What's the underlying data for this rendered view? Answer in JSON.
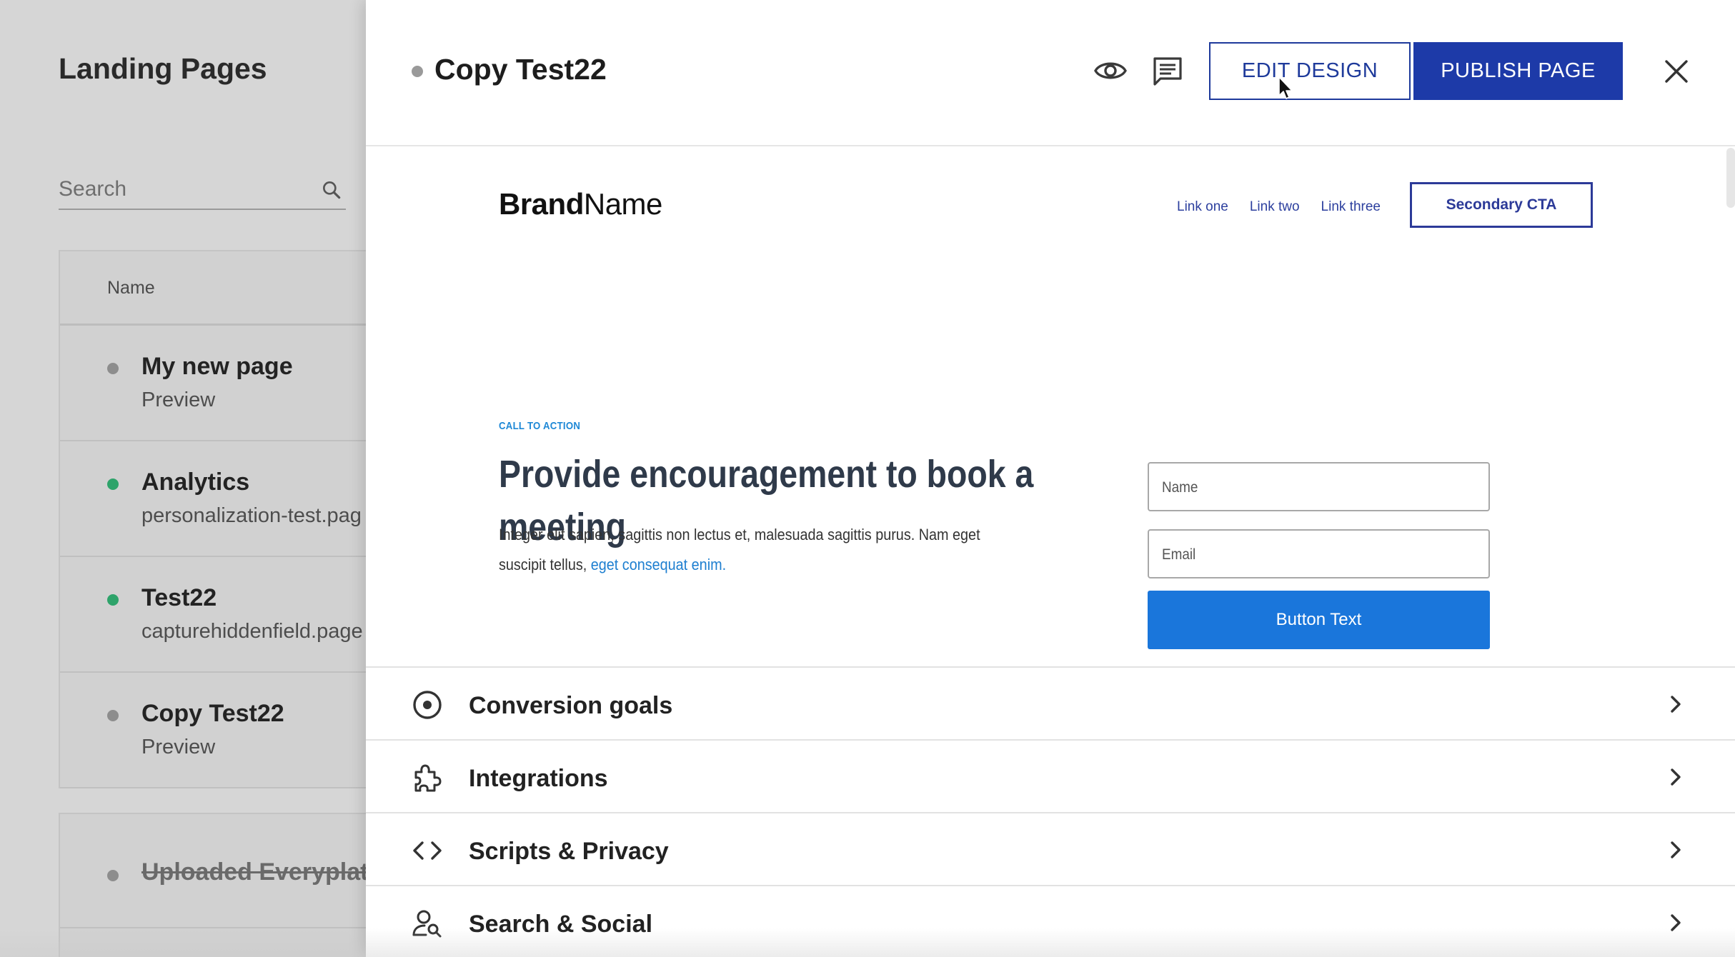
{
  "background": {
    "title": "Landing Pages",
    "search_placeholder": "Search",
    "table_header": "Name",
    "rows": [
      {
        "title": "My new page",
        "subtitle": "Preview",
        "status": "draft"
      },
      {
        "title": "Analytics",
        "subtitle": "personalization-test.pag",
        "status": "published"
      },
      {
        "title": "Test22",
        "subtitle": "capturehiddenfield.page",
        "status": "published"
      },
      {
        "title": "Copy Test22",
        "subtitle": "Preview",
        "status": "draft"
      }
    ],
    "archived_row": {
      "title": "Uploaded Everyplate"
    }
  },
  "panel": {
    "title": "Copy Test22",
    "status": "draft",
    "edit_label": "EDIT DESIGN",
    "publish_label": "PUBLISH PAGE",
    "icons": [
      "eye-icon",
      "comment-icon",
      "close-icon"
    ]
  },
  "preview": {
    "brand_bold": "Brand",
    "brand_regular": "Name",
    "nav_links": [
      "Link one",
      "Link two",
      "Link three"
    ],
    "secondary_cta": "Secondary CTA",
    "eyebrow": "CALL TO ACTION",
    "heading_line1": "Provide encouragement to book a",
    "heading_line2": "meeting",
    "body_text": "Integer elit sapien, sagittis non lectus et, malesuada sagittis purus. Nam eget suscipit tellus, ",
    "body_link": "eget consequat enim.",
    "name_placeholder": "Name",
    "email_placeholder": "Email",
    "button_text": "Button Text"
  },
  "settings": [
    {
      "label": "Conversion goals",
      "icon": "target-icon"
    },
    {
      "label": "Integrations",
      "icon": "puzzle-icon"
    },
    {
      "label": "Scripts & Privacy",
      "icon": "code-icon"
    },
    {
      "label": "Search & Social",
      "icon": "person-search-icon"
    }
  ],
  "colors": {
    "primary": "#1d3aa8",
    "accent_blue": "#1a76db",
    "status_green": "#2ea36a",
    "status_gray": "#9a9a9a"
  }
}
